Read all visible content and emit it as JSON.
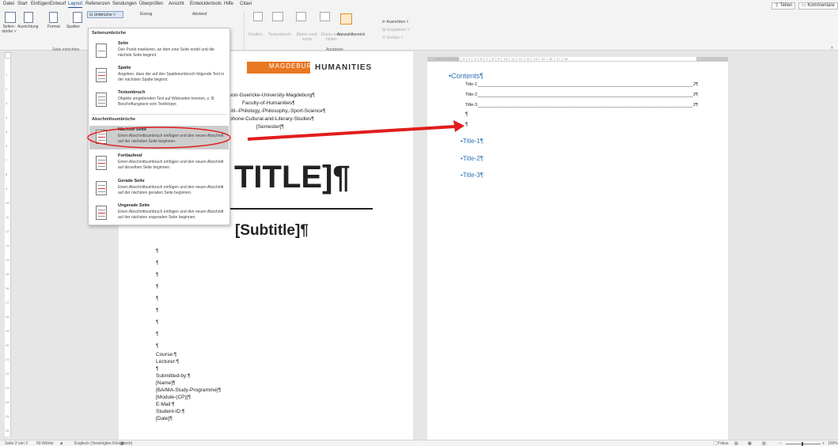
{
  "menubar": {
    "items": [
      "Datei",
      "Start",
      "Einfügen",
      "Entwurf",
      "Layout",
      "Referenzen",
      "Sendungen",
      "Überprüfen",
      "Ansicht",
      "Entwicklertools",
      "Hilfe",
      "Citavi"
    ],
    "share": "Teilen",
    "comments": "Kommentare"
  },
  "ribbon": {
    "margins": "Seiten-\nränder",
    "orientation": "Ausrichtung",
    "size": "Format",
    "columns": "Spalten",
    "breaks": "Umbrüche",
    "indent": "Einzug",
    "spacing": "Abstand",
    "group_page_setup": "Seite einrichten",
    "position": "Position",
    "wrap_text": "Textumbruch",
    "bring_forward": "Ebene nach vorne",
    "send_backward": "Ebene nach hinten",
    "selection_pane": "Auswahlbereich",
    "align": "Ausrichten",
    "group": "Gruppieren",
    "rotate": "Drehen",
    "group_arrange": "Anordnen"
  },
  "breaks_menu": {
    "section_page": "Seitenumbrüche",
    "section_section": "Abschnittsumbrüche",
    "items": [
      {
        "title": "Seite",
        "desc": "Den Punkt markieren, an dem eine Seite endet und die nächste Seite beginnt."
      },
      {
        "title": "Spalte",
        "desc": "Angeben, dass der auf den Spaltenumbruch folgende Text in der nächsten Spalte beginnt."
      },
      {
        "title": "Textumbruch",
        "desc": "Objekte umgebenden Text auf Webseiten trennen, z. B. Beschriftungstext vom Textkörper."
      },
      {
        "title": "Nächste Seite",
        "desc": "Einen Abschnittsumbruch einfügen und den neuen Abschnitt auf der nächsten Seite beginnen."
      },
      {
        "title": "Fortlaufend",
        "desc": "Einen Abschnittsumbruch einfügen und den neuen Abschnitt auf derselben Seite beginnen."
      },
      {
        "title": "Gerade Seite",
        "desc": "Einen Abschnittsumbruch einfügen und den neuen Abschnitt auf der nächsten geraden Seite beginnen."
      },
      {
        "title": "Ungerade Seite",
        "desc": "Einen Abschnittsumbruch einfügen und den neuen Abschnitt auf der nächsten ungeraden Seite beginnen."
      }
    ]
  },
  "page1": {
    "logo_text": "MAGDEBURG",
    "humanities": "HUMANITIES",
    "lines": [
      "von-Guericke-University-Magdeburg¶",
      "Faculty-of-Humanities¶",
      "-III--Philology,-Philosophy,-Sport-Science¶",
      "phone-Cultural-and-Literary-Studies¶",
      "[Semester]¶"
    ],
    "title": "TITLE]¶",
    "subtitle": "[Subtitle]¶",
    "pilcrow": "¶",
    "info": [
      "Course:¶",
      "Lecturer:¶",
      "¶",
      "Submitted-by:¶",
      "[Name]¶",
      "[BA/MA-Study-Programme]¶",
      "[Module-(CP)]¶",
      "E-Mail:¶",
      "Student-ID:¶",
      "[Date]¶"
    ]
  },
  "page2": {
    "contents": "Contents¶",
    "toc": [
      {
        "label": "Title-1",
        "page": "2¶"
      },
      {
        "label": "Title-2",
        "page": "2¶"
      },
      {
        "label": "Title-3",
        "page": "2¶"
      }
    ],
    "pilcrow": "¶",
    "headings": [
      "Title-1¶",
      "Title-2¶",
      "Title-3¶"
    ]
  },
  "statusbar": {
    "page": "Seite 2 von 2",
    "words": "50 Wörter",
    "language": "Englisch (Vereinigtes Königreich)",
    "focus": "Fokus",
    "zoom": "100%"
  },
  "colors": {
    "accent": "#1d4f91",
    "heading": "#2e74b5",
    "logo": "#e87722",
    "annotation": "#e11d1d"
  }
}
